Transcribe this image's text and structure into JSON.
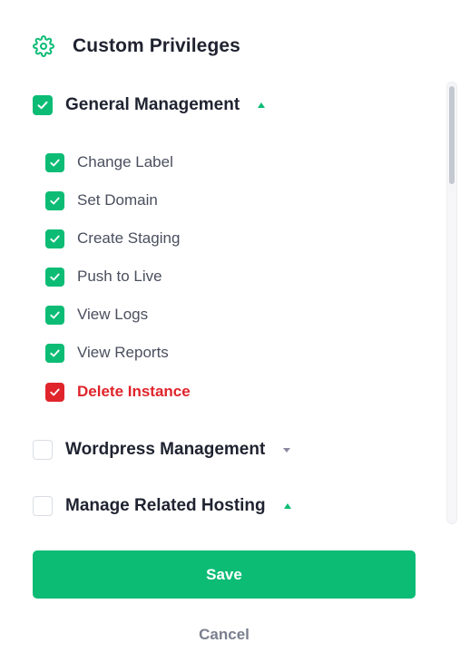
{
  "header": {
    "icon": "gear-icon",
    "title": "Custom Privileges"
  },
  "colors": {
    "accent": "#0cbc75",
    "danger": "#e0242b",
    "caret_collapsed": "#8b8aa3"
  },
  "groups": [
    {
      "label": "General Management",
      "checked": true,
      "expanded": true,
      "items": [
        {
          "label": "Change Label",
          "checked": true
        },
        {
          "label": "Set Domain",
          "checked": true
        },
        {
          "label": "Create Staging",
          "checked": true
        },
        {
          "label": "Push to Live",
          "checked": true
        },
        {
          "label": "View Logs",
          "checked": true
        },
        {
          "label": "View Reports",
          "checked": true
        },
        {
          "label": "Delete Instance",
          "checked": true,
          "danger": true
        }
      ]
    },
    {
      "label": "Wordpress Management",
      "checked": false,
      "expanded": false
    },
    {
      "label": "Manage Related Hosting",
      "checked": false,
      "expanded": true
    }
  ],
  "actions": {
    "save_label": "Save",
    "cancel_label": "Cancel"
  }
}
